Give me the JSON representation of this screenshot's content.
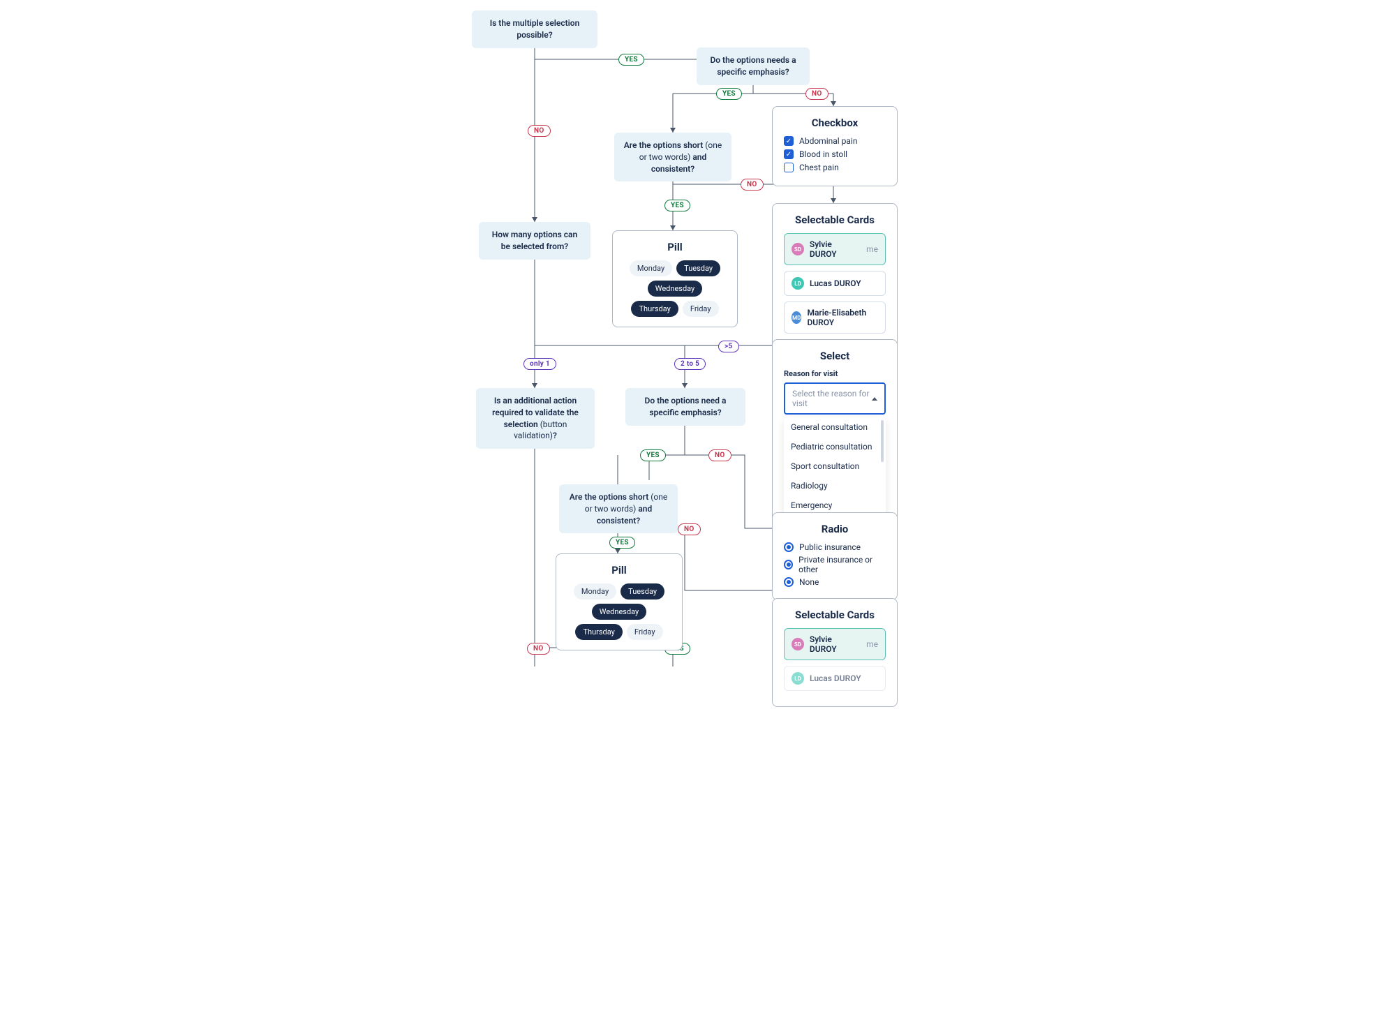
{
  "labels": {
    "yes": "YES",
    "no": "NO",
    "only1": "only 1",
    "twoTo5": "2 to 5",
    "gt5": ">5"
  },
  "questions": {
    "q1": "Is the multiple selection possible?",
    "q2": "Do the options needs a specific emphasis?",
    "q3_a": "Are the options short ",
    "q3_b": "(one or two words)",
    "q3_c": " and consistent?",
    "q4": "How many options can be selected from?",
    "q5_a": "Is an additional action required to validate the selection ",
    "q5_b": "(button validation)",
    "q5_c": "?",
    "q6": "Do the options need a specific emphasis?",
    "q7_a": "Are the options short ",
    "q7_b": "(one or two words)",
    "q7_c": " and consistent?"
  },
  "checkbox": {
    "title": "Checkbox",
    "items": [
      {
        "label": "Abdominal pain",
        "checked": true
      },
      {
        "label": "Blood in stoll",
        "checked": true
      },
      {
        "label": "Chest pain",
        "checked": false
      }
    ]
  },
  "pill1": {
    "title": "Pill",
    "items": [
      {
        "label": "Monday",
        "sel": false
      },
      {
        "label": "Tuesday",
        "sel": true
      },
      {
        "label": "Wednesday",
        "sel": true
      },
      {
        "label": "Thursday",
        "sel": true
      },
      {
        "label": "Friday",
        "sel": false
      }
    ]
  },
  "pill2": {
    "title": "Pill",
    "items": [
      {
        "label": "Monday",
        "sel": false
      },
      {
        "label": "Tuesday",
        "sel": true
      },
      {
        "label": "Wednesday",
        "sel": true
      },
      {
        "label": "Thursday",
        "sel": true
      },
      {
        "label": "Friday",
        "sel": false
      }
    ]
  },
  "cards1": {
    "title": "Selectable Cards",
    "items": [
      {
        "initials": "SD",
        "name": "Sylvie DUROY",
        "me": "me",
        "sel": true,
        "av": "pink"
      },
      {
        "initials": "LD",
        "name": "Lucas DUROY",
        "me": "",
        "sel": false,
        "av": "teal"
      },
      {
        "initials": "MD",
        "name": "Marie-Elisabeth DUROY",
        "me": "",
        "sel": false,
        "av": "blue"
      }
    ]
  },
  "cards2": {
    "title": "Selectable Cards",
    "items": [
      {
        "initials": "SD",
        "name": "Sylvie DUROY",
        "me": "me",
        "sel": true,
        "av": "pink"
      },
      {
        "initials": "LD",
        "name": "Lucas DUROY",
        "me": "",
        "sel": false,
        "av": "teal"
      }
    ]
  },
  "select": {
    "title": "Select",
    "field_label": "Reason for visit",
    "placeholder": "Select the reason for visit",
    "options": [
      "General consultation",
      "Pediatric consultation",
      "Sport consultation",
      "Radiology",
      "Emergency"
    ]
  },
  "radio": {
    "title": "Radio",
    "items": [
      "Public insurance",
      "Private insurance or other",
      "None"
    ]
  }
}
